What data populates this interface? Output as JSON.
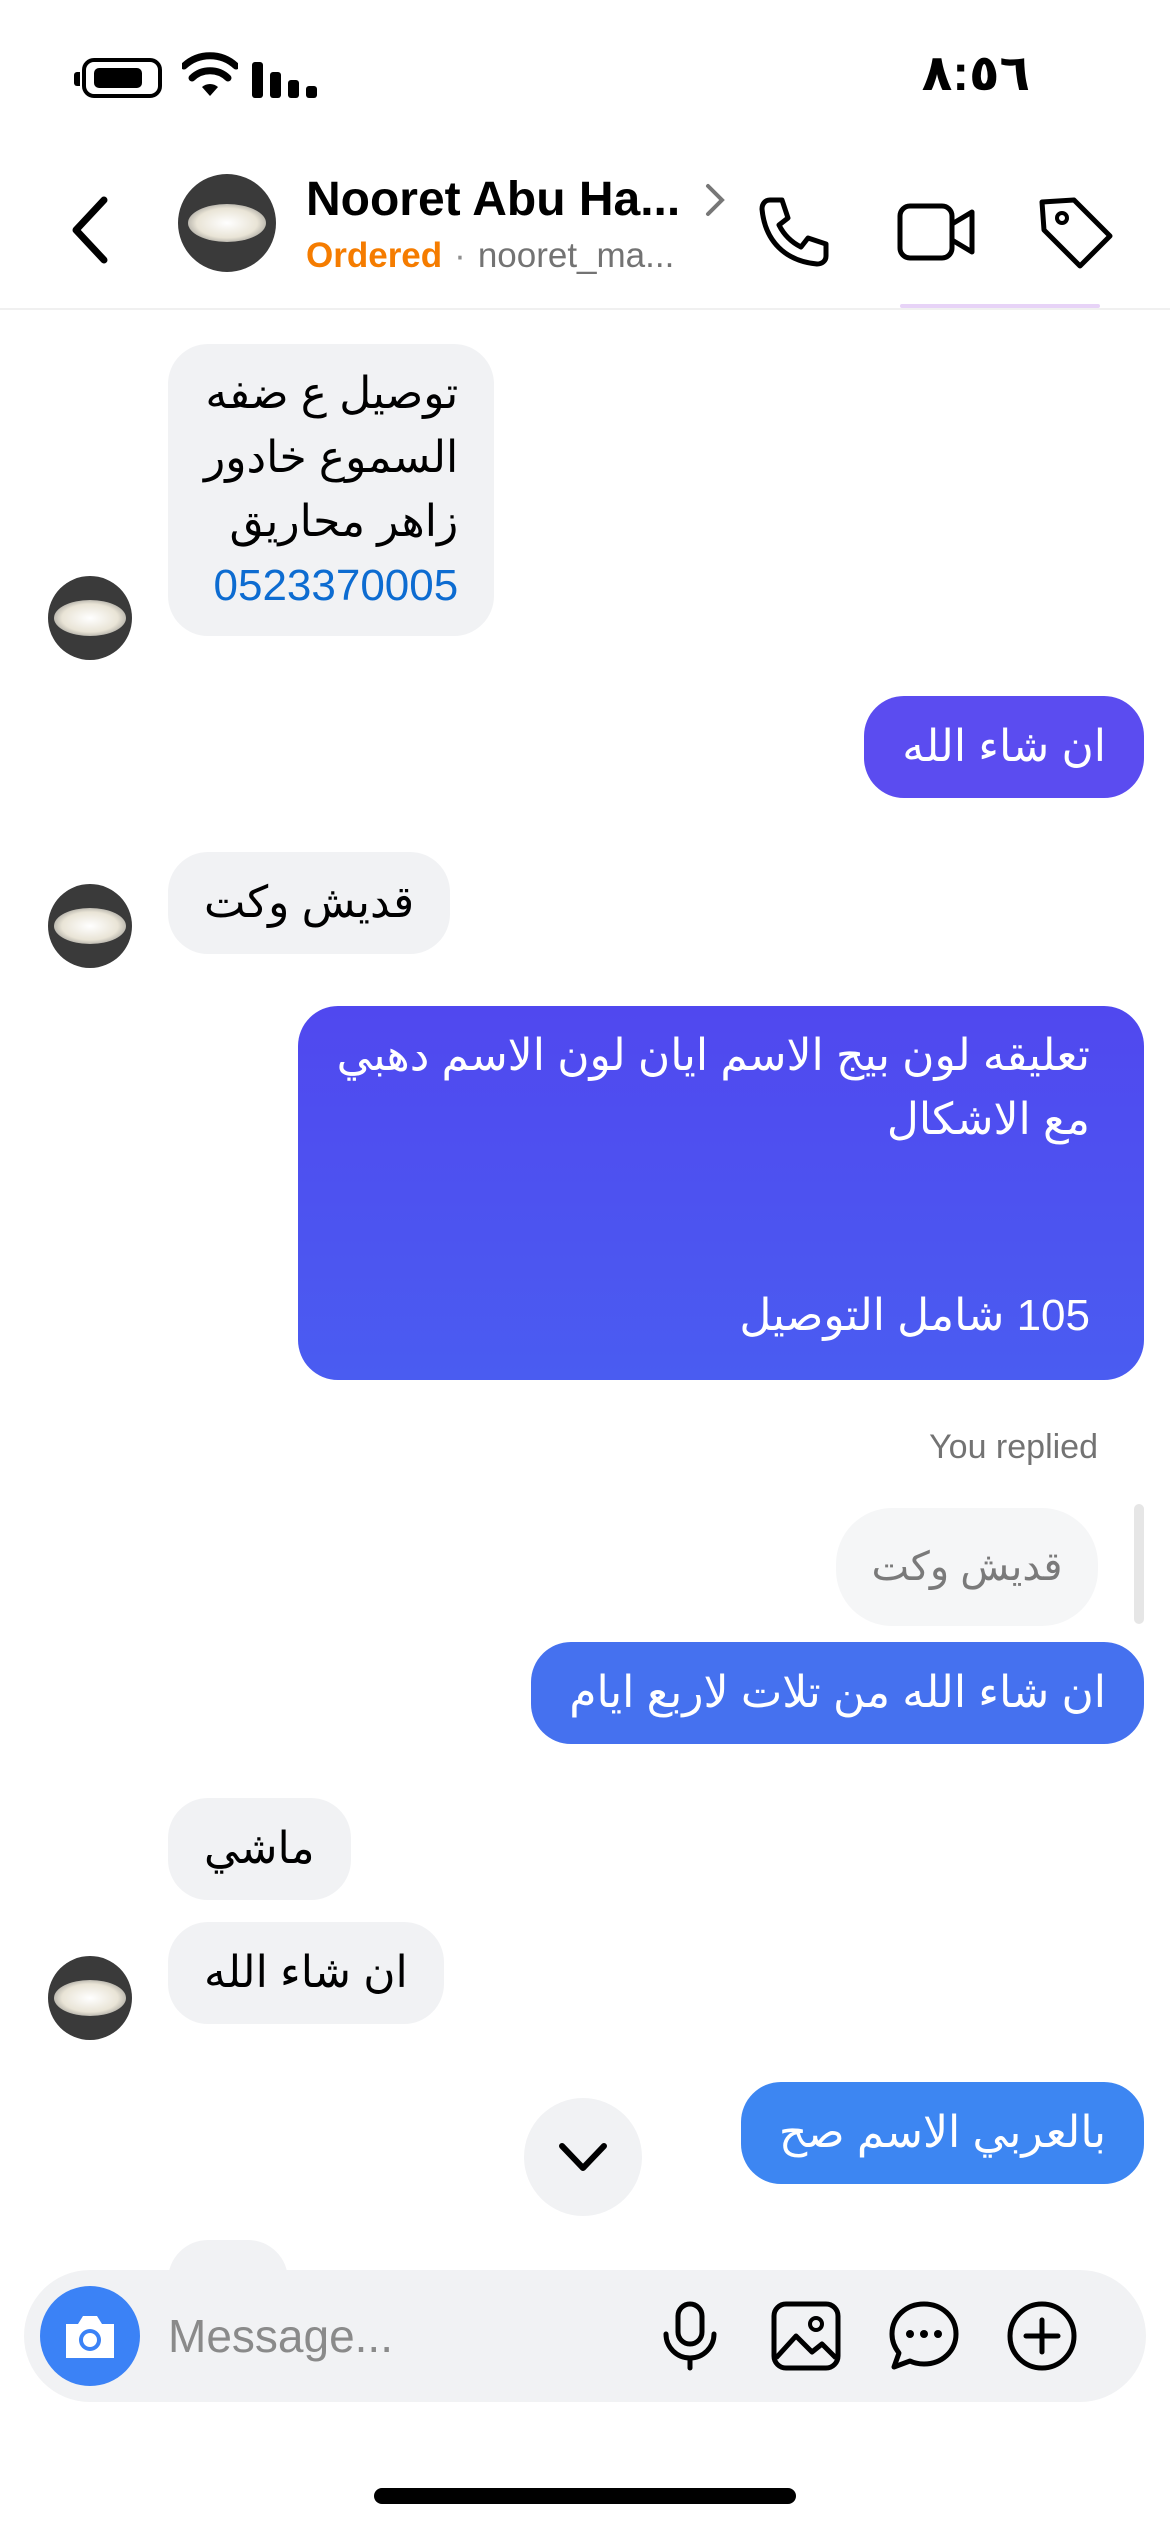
{
  "status_bar": {
    "time": "٨:٥٦"
  },
  "header": {
    "name": "Nooret Abu Ha...",
    "status": "Ordered",
    "handle": "nooret_ma..."
  },
  "messages": {
    "m1_line1": "توصيل ع ضفه",
    "m1_line2": "السموع خادور",
    "m1_line3": "زاهر محاريق",
    "m1_phone": "0523370005",
    "m2": "ان شاء الله",
    "m3": "قديش وكت",
    "m4_line1": "تعليقه لون بيج الاسم ايان لون الاسم دهبي",
    "m4_line2": "مع الاشكال",
    "m4_line3": "105 شامل التوصيل",
    "replied_label": "You replied",
    "reply_quote": "قديش وكت",
    "m5": "ان شاء الله من تلات لاربع ايام",
    "m6": "ماشي",
    "m7": "ان شاء الله",
    "m8": "بالعربي الاسم صح"
  },
  "composer": {
    "placeholder": "Message..."
  },
  "colors": {
    "accent_purple": "#5b4cf0",
    "accent_indigo": "#4f55ef",
    "accent_blue": "#3f73ef",
    "accent_sky": "#3b82f6",
    "ordered_orange": "#f57c00",
    "incoming_bg": "#f1f2f4"
  },
  "icons": [
    "back-icon",
    "chevron-right-icon",
    "phone-icon",
    "video-icon",
    "tag-icon",
    "camera-icon",
    "microphone-icon",
    "image-icon",
    "sticker-icon",
    "plus-icon",
    "chevron-down-icon"
  ]
}
